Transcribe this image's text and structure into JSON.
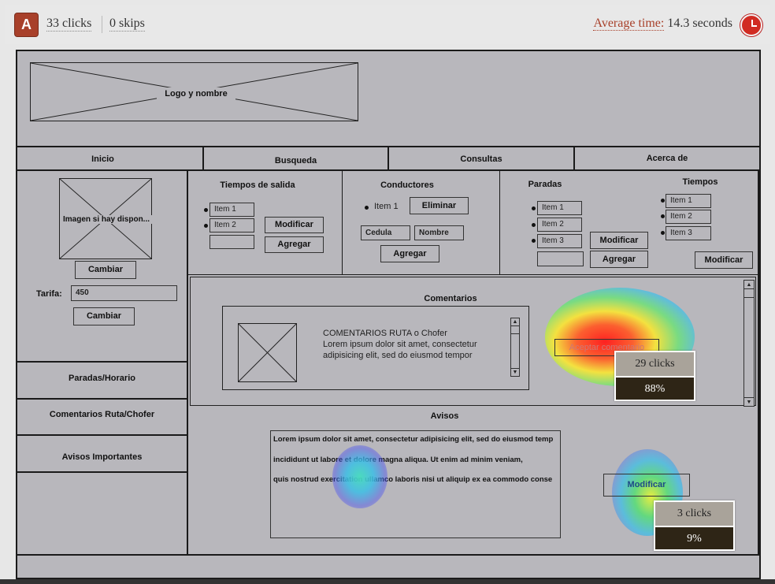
{
  "topbar": {
    "badge": "A",
    "clicks": "33 clicks",
    "skips": "0 skips",
    "avg_label": "Average time:",
    "avg_value": " 14.3 seconds"
  },
  "wireframe": {
    "logo_label": "Logo y nombre",
    "nav": [
      "Inicio",
      "Busqueda",
      "Consultas",
      "Acerca de"
    ],
    "left": {
      "image_label": "Imagen si hay dispon...",
      "change_btn": "Cambiar",
      "tarifa_label": "Tarifa:",
      "tarifa_value": "450",
      "change_btn2": "Cambiar",
      "links": [
        "Paradas/Horario",
        "Comentarios Ruta/Chofer",
        "Avisos Importantes"
      ]
    },
    "tiempos_salida": {
      "title": "Tiempos de salida",
      "items": [
        "Item 1",
        "Item 2"
      ],
      "modify": "Modificar",
      "add": "Agregar"
    },
    "conductores": {
      "title": "Conductores",
      "item": "Item 1",
      "remove": "Eliminar",
      "cedula": "Cedula",
      "nombre": "Nombre",
      "add": "Agregar"
    },
    "paradas": {
      "title": "Paradas",
      "items": [
        "Item 1",
        "Item 2",
        "Item 3"
      ],
      "modify": "Modificar",
      "add": "Agregar"
    },
    "tiempos": {
      "title": "Tiempos",
      "items": [
        "Item 1",
        "Item 2",
        "Item 3"
      ],
      "modify": "Modificar"
    },
    "comentarios": {
      "title": "Comentarios",
      "heading": "COMENTARIOS RUTA o Chofer",
      "line1": " Lorem ipsum dolor sit amet, consectetur",
      "line2": "adipisicing elit, sed do eiusmod tempor",
      "accept": "Aceptar comentario"
    },
    "avisos": {
      "title": "Avisos",
      "line1": "Lorem ipsum dolor sit amet, consectetur adipisicing elit, sed do eiusmod temp",
      "line2": "incididunt ut labore et dolore magna aliqua. Ut enim ad minim veniam,",
      "line3": "quis nostrud exercitation ullamco laboris nisi ut aliquip ex ea commodo conse",
      "modify": "Modificar"
    }
  },
  "heat_callouts": [
    {
      "clicks": "29 clicks",
      "pct": "88%"
    },
    {
      "clicks": "3 clicks",
      "pct": "9%"
    }
  ],
  "colors": {
    "accent": "#a8402a",
    "wire_bg": "#b8b7bc",
    "callout_dark": "#2e2516"
  },
  "icons": {
    "timer": "stopwatch-icon",
    "image_placeholder": "x-box"
  }
}
